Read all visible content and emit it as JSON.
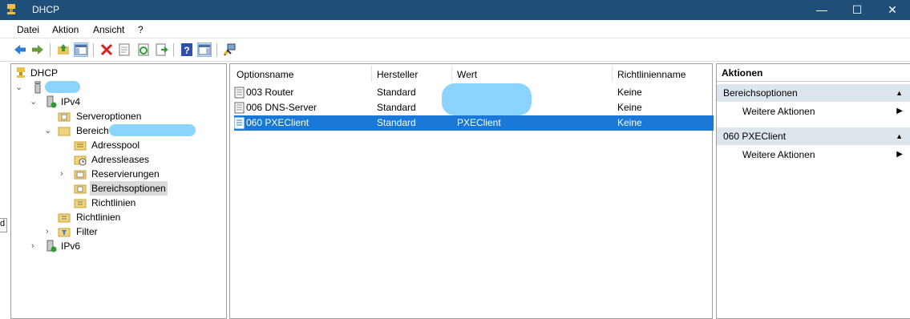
{
  "window": {
    "title": "DHCP",
    "minimize": "—",
    "maximize": "☐",
    "close": "✕"
  },
  "menu": [
    "Datei",
    "Aktion",
    "Ansicht",
    "?"
  ],
  "tree": {
    "root": "DHCP",
    "ipv4": "IPv4",
    "serveroptionen": "Serveroptionen",
    "bereich_prefix": "Bereich",
    "adresspool": "Adresspool",
    "adressleases": "Adressleases",
    "reservierungen": "Reservierungen",
    "bereichsoptionen": "Bereichsoptionen",
    "richtlinien_scope": "Richtlinien",
    "richtlinien": "Richtlinien",
    "filter": "Filter",
    "ipv6": "IPv6"
  },
  "list": {
    "columns": [
      "Optionsname",
      "Hersteller",
      "Wert",
      "Richtlinienname"
    ],
    "rows": [
      {
        "name": "003 Router",
        "vendor": "Standard",
        "value": "",
        "policy": "Keine"
      },
      {
        "name": "006 DNS-Server",
        "vendor": "Standard",
        "value": "",
        "policy": "Keine"
      },
      {
        "name": "060 PXEClient",
        "vendor": "Standard",
        "value": "PXEClient",
        "policy": "Keine"
      }
    ]
  },
  "actions": {
    "header": "Aktionen",
    "section1": {
      "title": "Bereichsoptionen",
      "item": "Weitere Aktionen"
    },
    "section2": {
      "title": "060 PXEClient",
      "item": "Weitere Aktionen"
    }
  },
  "left_edge_label": "d",
  "colors": {
    "titlebar": "#1f4e79",
    "selection": "#1a78d6",
    "action_section": "#dde5ed",
    "redaction": "#8ad4ff"
  }
}
